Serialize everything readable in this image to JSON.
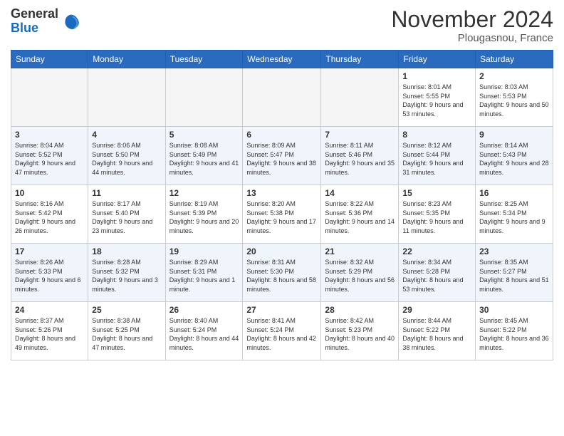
{
  "logo": {
    "general": "General",
    "blue": "Blue"
  },
  "header": {
    "month": "November 2024",
    "location": "Plougasnou, France"
  },
  "weekdays": [
    "Sunday",
    "Monday",
    "Tuesday",
    "Wednesday",
    "Thursday",
    "Friday",
    "Saturday"
  ],
  "weeks": [
    [
      {
        "day": "",
        "empty": true
      },
      {
        "day": "",
        "empty": true
      },
      {
        "day": "",
        "empty": true
      },
      {
        "day": "",
        "empty": true
      },
      {
        "day": "",
        "empty": true
      },
      {
        "day": "1",
        "sunrise": "8:01 AM",
        "sunset": "5:55 PM",
        "daylight": "9 hours and 53 minutes."
      },
      {
        "day": "2",
        "sunrise": "8:03 AM",
        "sunset": "5:53 PM",
        "daylight": "9 hours and 50 minutes."
      }
    ],
    [
      {
        "day": "3",
        "sunrise": "8:04 AM",
        "sunset": "5:52 PM",
        "daylight": "9 hours and 47 minutes."
      },
      {
        "day": "4",
        "sunrise": "8:06 AM",
        "sunset": "5:50 PM",
        "daylight": "9 hours and 44 minutes."
      },
      {
        "day": "5",
        "sunrise": "8:08 AM",
        "sunset": "5:49 PM",
        "daylight": "9 hours and 41 minutes."
      },
      {
        "day": "6",
        "sunrise": "8:09 AM",
        "sunset": "5:47 PM",
        "daylight": "9 hours and 38 minutes."
      },
      {
        "day": "7",
        "sunrise": "8:11 AM",
        "sunset": "5:46 PM",
        "daylight": "9 hours and 35 minutes."
      },
      {
        "day": "8",
        "sunrise": "8:12 AM",
        "sunset": "5:44 PM",
        "daylight": "9 hours and 31 minutes."
      },
      {
        "day": "9",
        "sunrise": "8:14 AM",
        "sunset": "5:43 PM",
        "daylight": "9 hours and 28 minutes."
      }
    ],
    [
      {
        "day": "10",
        "sunrise": "8:16 AM",
        "sunset": "5:42 PM",
        "daylight": "9 hours and 26 minutes."
      },
      {
        "day": "11",
        "sunrise": "8:17 AM",
        "sunset": "5:40 PM",
        "daylight": "9 hours and 23 minutes."
      },
      {
        "day": "12",
        "sunrise": "8:19 AM",
        "sunset": "5:39 PM",
        "daylight": "9 hours and 20 minutes."
      },
      {
        "day": "13",
        "sunrise": "8:20 AM",
        "sunset": "5:38 PM",
        "daylight": "9 hours and 17 minutes."
      },
      {
        "day": "14",
        "sunrise": "8:22 AM",
        "sunset": "5:36 PM",
        "daylight": "9 hours and 14 minutes."
      },
      {
        "day": "15",
        "sunrise": "8:23 AM",
        "sunset": "5:35 PM",
        "daylight": "9 hours and 11 minutes."
      },
      {
        "day": "16",
        "sunrise": "8:25 AM",
        "sunset": "5:34 PM",
        "daylight": "9 hours and 9 minutes."
      }
    ],
    [
      {
        "day": "17",
        "sunrise": "8:26 AM",
        "sunset": "5:33 PM",
        "daylight": "9 hours and 6 minutes."
      },
      {
        "day": "18",
        "sunrise": "8:28 AM",
        "sunset": "5:32 PM",
        "daylight": "9 hours and 3 minutes."
      },
      {
        "day": "19",
        "sunrise": "8:29 AM",
        "sunset": "5:31 PM",
        "daylight": "9 hours and 1 minute."
      },
      {
        "day": "20",
        "sunrise": "8:31 AM",
        "sunset": "5:30 PM",
        "daylight": "8 hours and 58 minutes."
      },
      {
        "day": "21",
        "sunrise": "8:32 AM",
        "sunset": "5:29 PM",
        "daylight": "8 hours and 56 minutes."
      },
      {
        "day": "22",
        "sunrise": "8:34 AM",
        "sunset": "5:28 PM",
        "daylight": "8 hours and 53 minutes."
      },
      {
        "day": "23",
        "sunrise": "8:35 AM",
        "sunset": "5:27 PM",
        "daylight": "8 hours and 51 minutes."
      }
    ],
    [
      {
        "day": "24",
        "sunrise": "8:37 AM",
        "sunset": "5:26 PM",
        "daylight": "8 hours and 49 minutes."
      },
      {
        "day": "25",
        "sunrise": "8:38 AM",
        "sunset": "5:25 PM",
        "daylight": "8 hours and 47 minutes."
      },
      {
        "day": "26",
        "sunrise": "8:40 AM",
        "sunset": "5:24 PM",
        "daylight": "8 hours and 44 minutes."
      },
      {
        "day": "27",
        "sunrise": "8:41 AM",
        "sunset": "5:24 PM",
        "daylight": "8 hours and 42 minutes."
      },
      {
        "day": "28",
        "sunrise": "8:42 AM",
        "sunset": "5:23 PM",
        "daylight": "8 hours and 40 minutes."
      },
      {
        "day": "29",
        "sunrise": "8:44 AM",
        "sunset": "5:22 PM",
        "daylight": "8 hours and 38 minutes."
      },
      {
        "day": "30",
        "sunrise": "8:45 AM",
        "sunset": "5:22 PM",
        "daylight": "8 hours and 36 minutes."
      }
    ]
  ]
}
